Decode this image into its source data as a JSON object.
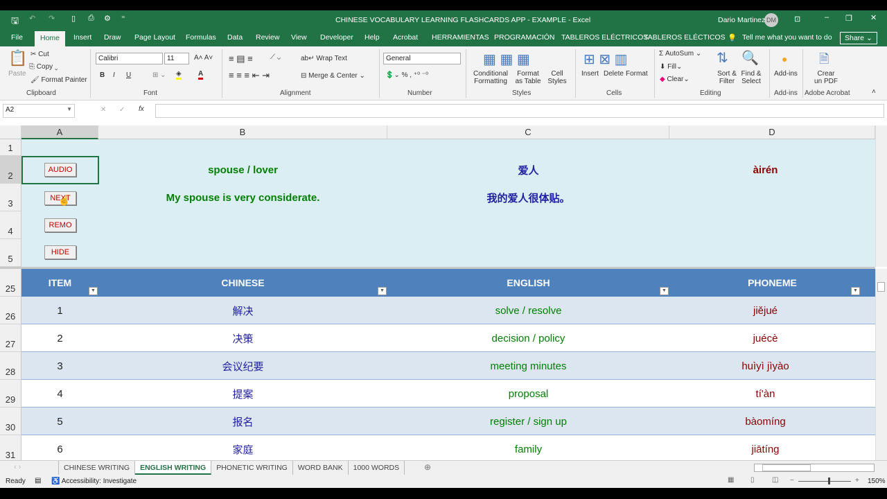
{
  "title": "CHINESE VOCABULARY LEARNING FLASHCARDS APP - EXAMPLE  -  Excel",
  "user": {
    "name": "Dario Martinez",
    "initials": "DM"
  },
  "menu_tabs": [
    "File",
    "Home",
    "Insert",
    "Draw",
    "Page Layout",
    "Formulas",
    "Data",
    "Review",
    "View",
    "Developer",
    "Help",
    "Acrobat",
    "HERRAMIENTAS",
    "PROGRAMACIÓN",
    "TABLEROS ELÉCTRICOS",
    "TABLEROS ELÉCTICOS"
  ],
  "tell_me": "Tell me what you want to do",
  "share": "Share",
  "ribbon": {
    "clipboard": {
      "paste": "Paste",
      "cut": "Cut",
      "copy": "Copy",
      "format_painter": "Format Painter",
      "label": "Clipboard"
    },
    "font": {
      "name": "Calibri",
      "size": "11",
      "label": "Font",
      "bold": "B",
      "italic": "I",
      "underline": "U"
    },
    "alignment": {
      "wrap": "Wrap Text",
      "merge": "Merge & Center",
      "label": "Alignment"
    },
    "number": {
      "format": "General",
      "label": "Number"
    },
    "styles": {
      "cond": "Conditional Formatting",
      "table": "Format as Table",
      "cell": "Cell Styles",
      "label": "Styles"
    },
    "cells": {
      "insert": "Insert",
      "delete": "Delete",
      "format": "Format",
      "label": "Cells"
    },
    "editing": {
      "autosum": "AutoSum",
      "fill": "Fill",
      "clear": "Clear",
      "sort": "Sort & Filter",
      "find": "Find & Select",
      "label": "Editing"
    },
    "addins": {
      "btn": "Add-ins",
      "label": "Add-ins"
    },
    "acrobat": {
      "btn": "Crear un PDF",
      "label": "Adobe Acrobat"
    }
  },
  "name_box": "A2",
  "formula": "",
  "columns": [
    "A",
    "B",
    "C",
    "D"
  ],
  "top_rows": [
    "1",
    "2",
    "3",
    "4",
    "5"
  ],
  "buttons": [
    "AUDIO",
    "NEXT",
    "REMO",
    "HIDE"
  ],
  "card": {
    "english": "spouse / lover",
    "chinese": "爱人",
    "phoneme": "àirén",
    "sentence_en": "My spouse is very considerate.",
    "sentence_zh": "我的爱人很体贴。"
  },
  "table": {
    "headers": [
      "ITEM",
      "CHINESE",
      "ENGLISH",
      "PHONEME"
    ],
    "rows": [
      {
        "row": "26",
        "item": "1",
        "chinese": "解决",
        "english": "solve / resolve",
        "phoneme": "jiějué"
      },
      {
        "row": "27",
        "item": "2",
        "chinese": "决策",
        "english": "decision / policy",
        "phoneme": "juécè"
      },
      {
        "row": "28",
        "item": "3",
        "chinese": "会议纪要",
        "english": "meeting minutes",
        "phoneme": "huìyì jìyào"
      },
      {
        "row": "29",
        "item": "4",
        "chinese": "提案",
        "english": "proposal",
        "phoneme": "tí'àn"
      },
      {
        "row": "30",
        "item": "5",
        "chinese": "报名",
        "english": "register / sign up",
        "phoneme": "bàomíng"
      },
      {
        "row": "31",
        "item": "6",
        "chinese": "家庭",
        "english": "family",
        "phoneme": "jiātíng"
      }
    ],
    "header_row": "25"
  },
  "sheets": [
    "CHINESE WRITING",
    "ENGLISH WRITING",
    "PHONETIC WRITING",
    "WORD BANK",
    "1000 WORDS"
  ],
  "active_sheet": "ENGLISH WRITING",
  "status": {
    "ready": "Ready",
    "accessibility": "Accessibility: Investigate",
    "zoom": "150%"
  },
  "colors": {
    "excel_green": "#217346",
    "card_bg": "#daeef3",
    "table_header": "#4f81bd",
    "band": "#dce6f1",
    "english": "#008000",
    "chinese": "#1f1fa0",
    "phoneme": "#8b0000"
  }
}
